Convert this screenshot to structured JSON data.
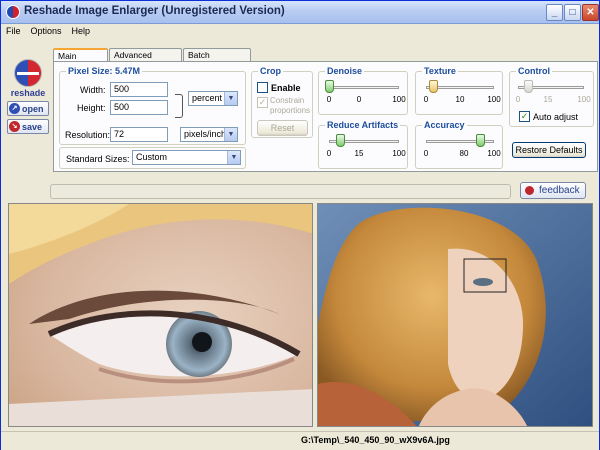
{
  "window": {
    "title": "Reshade Image Enlarger (Unregistered Version)",
    "minimize": "_",
    "maximize": "□",
    "close": "✕"
  },
  "menu": [
    "File",
    "Options",
    "Help"
  ],
  "sidebar": {
    "logo_text": "reshade",
    "open_label": "open",
    "save_label": "save"
  },
  "tabs": [
    "Main Options",
    "Advanced Options",
    "Batch Processing"
  ],
  "pixel_size": {
    "title": "Pixel Size: 5.47M",
    "width_label": "Width:",
    "width_value": "500",
    "height_label": "Height:",
    "height_value": "500",
    "unit": "percent",
    "resolution_label": "Resolution:",
    "resolution_value": "72",
    "resolution_unit": "pixels/inch"
  },
  "standard_sizes": {
    "label": "Standard Sizes:",
    "value": "Custom"
  },
  "crop": {
    "title": "Crop",
    "enable_label": "Enable",
    "enable_checked": false,
    "constrain_label": "Constrain proportions",
    "constrain_checked": true,
    "reset_label": "Reset"
  },
  "denoise": {
    "title": "Denoise",
    "min": "0",
    "mid": "0",
    "max": "100",
    "value": 0
  },
  "texture": {
    "title": "Texture",
    "min": "0",
    "mid": "10",
    "max": "100",
    "value": 10
  },
  "control": {
    "title": "Control",
    "min": "0",
    "mid": "15",
    "max": "100",
    "value": 15,
    "auto_label": "Auto adjust",
    "auto_checked": true
  },
  "reduce_artifacts": {
    "title": "Reduce Artifacts",
    "min": "0",
    "mid": "15",
    "max": "100",
    "value": 15
  },
  "accuracy": {
    "title": "Accuracy",
    "min": "0",
    "mid": "80",
    "max": "100",
    "value": 80
  },
  "restore_label": "Restore Defaults",
  "feedback_label": "feedback",
  "status": {
    "file": "G:\\Temp\\_540_450_90_wX9v6A.jpg"
  },
  "icons": {
    "logo": "reshade-logo-icon",
    "open": "open-icon",
    "save": "save-icon",
    "feedback": "ladybug-icon"
  },
  "colors": {
    "group_title": "#1d4d9c",
    "slider_thumb": "#7fcc6e",
    "title_bar": "#b9cdf2"
  }
}
